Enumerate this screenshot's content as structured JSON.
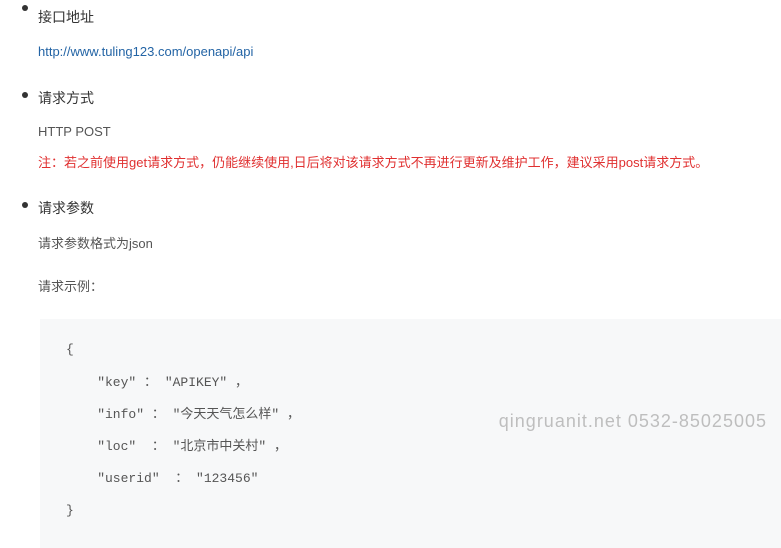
{
  "sections": {
    "api_url": {
      "heading": "接口地址",
      "url": "http://www.tuling123.com/openapi/api"
    },
    "request_method": {
      "heading": "请求方式",
      "method": "HTTP POST",
      "note": "注：若之前使用get请求方式，仍能继续使用,日后将对该请求方式不再进行更新及维护工作，建议采用post请求方式。"
    },
    "request_params": {
      "heading": "请求参数",
      "desc": "请求参数格式为json",
      "example_label": "请求示例：",
      "code": {
        "line1": "{",
        "line2": "    \"key\" ： \"APIKEY\" ，",
        "line3": "    \"info\" ： \"今天天气怎么样\" ，",
        "line4": "    \"loc\"  ： \"北京市中关村\" ，",
        "line5": "    \"userid\"  ： \"123456\"",
        "line6": "}"
      }
    }
  },
  "watermark": "qingruanit.net 0532-85025005"
}
